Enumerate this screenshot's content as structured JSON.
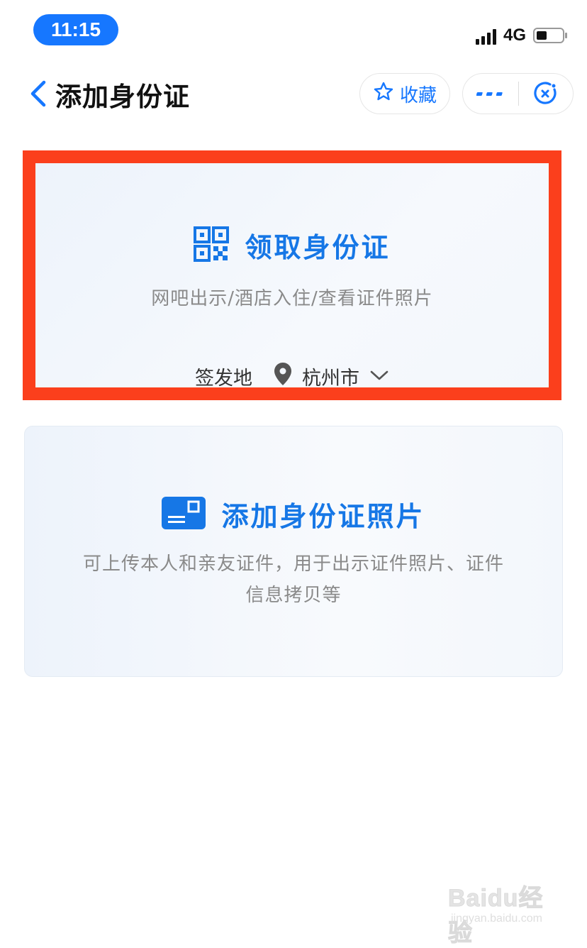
{
  "status_bar": {
    "time": "11:15",
    "network": "4G",
    "battery_level": 0.35
  },
  "header": {
    "title": "添加身份证",
    "favorite_label": "收藏",
    "accent_color": "#1677ff"
  },
  "card_get_id": {
    "title": "领取身份证",
    "subtitle": "网吧出示/酒店入住/查看证件照片",
    "issue_label": "签发地",
    "city": "杭州市",
    "highlight_color": "#fb3f1c"
  },
  "card_add_photo": {
    "title": "添加身份证照片",
    "description": "可上传本人和亲友证件，用于出示证件照片、证件信息拷贝等"
  },
  "watermark": {
    "brand": "Baidu经验",
    "url": "jingyan.baidu.com"
  }
}
